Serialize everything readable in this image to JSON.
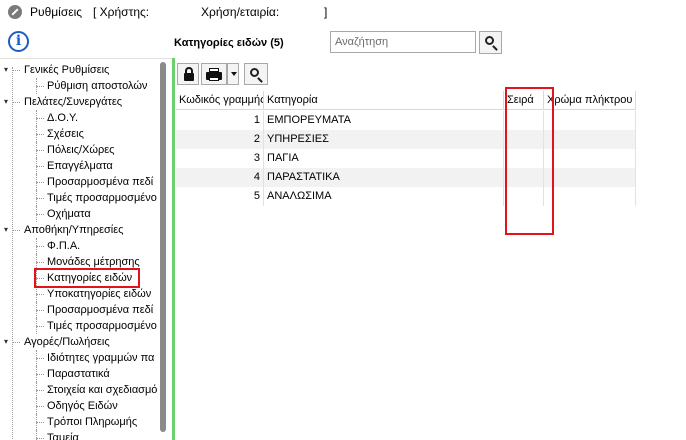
{
  "titlebar": {
    "title": "Ρυθμίσεις",
    "user_label": "[ Χρήστης:",
    "company_label": "Χρήση/εταιρία:",
    "close_bracket": "]"
  },
  "tree": {
    "items": [
      {
        "label": "Γενικές Ρυθμίσεις",
        "level": 0,
        "expanded": true
      },
      {
        "label": "Ρύθμιση αποστολών",
        "level": 1
      },
      {
        "label": "Πελάτες/Συνεργάτες",
        "level": 0,
        "expanded": true
      },
      {
        "label": "Δ.Ο.Υ.",
        "level": 1
      },
      {
        "label": "Σχέσεις",
        "level": 1
      },
      {
        "label": "Πόλεις/Χώρες",
        "level": 1
      },
      {
        "label": "Επαγγέλματα",
        "level": 1
      },
      {
        "label": "Προσαρμοσμένα πεδί",
        "level": 1
      },
      {
        "label": "Τιμές προσαρμοσμένο",
        "level": 1
      },
      {
        "label": "Οχήματα",
        "level": 1
      },
      {
        "label": "Αποθήκη/Υπηρεσίες",
        "level": 0,
        "expanded": true
      },
      {
        "label": "Φ.Π.Α.",
        "level": 1
      },
      {
        "label": "Μονάδες μέτρησης",
        "level": 1
      },
      {
        "label": "Κατηγορίες ειδών",
        "level": 1,
        "selected": true
      },
      {
        "label": "Υποκατηγορίες ειδών",
        "level": 1
      },
      {
        "label": "Προσαρμοσμένα πεδί",
        "level": 1
      },
      {
        "label": "Τιμές προσαρμοσμένο",
        "level": 1
      },
      {
        "label": "Αγορές/Πωλήσεις",
        "level": 0,
        "expanded": true
      },
      {
        "label": "Ιδιότητες γραμμών πα",
        "level": 1
      },
      {
        "label": "Παραστατικά",
        "level": 1
      },
      {
        "label": "Στοιχεία και σχεδιασμό",
        "level": 1
      },
      {
        "label": "Οδηγός Ειδών",
        "level": 1
      },
      {
        "label": "Τρόποι Πληρωμής",
        "level": 1
      },
      {
        "label": "Ταμεία",
        "level": 1
      }
    ]
  },
  "panel": {
    "title": "Κατηγορίες ειδών (5)",
    "search_placeholder": "Αναζήτηση"
  },
  "toolbar": {
    "lock_icon": "lock-icon",
    "print_icon": "printer-icon",
    "search_icon": "search-icon"
  },
  "grid": {
    "columns": [
      "Κωδικός γραμμής",
      "Κατηγορία",
      "Σειρά",
      "Χρώμα πλήκτρου"
    ],
    "rows": [
      {
        "code": "1",
        "category": "ΕΜΠΟΡΕΥΜΑΤΑ",
        "order": "",
        "color": ""
      },
      {
        "code": "2",
        "category": "ΥΠΗΡΕΣΙΕΣ",
        "order": "",
        "color": ""
      },
      {
        "code": "3",
        "category": "ΠΑΓΙΑ",
        "order": "",
        "color": ""
      },
      {
        "code": "4",
        "category": "ΠΑΡΑΣΤΑΤΙΚΑ",
        "order": "",
        "color": ""
      },
      {
        "code": "5",
        "category": "ΑΝΑΛΩΣΙΜΑ",
        "order": "",
        "color": ""
      }
    ]
  },
  "colors": {
    "highlight": "#e0141b",
    "divider": "#6cd16c",
    "info": "#1e5cc5"
  }
}
